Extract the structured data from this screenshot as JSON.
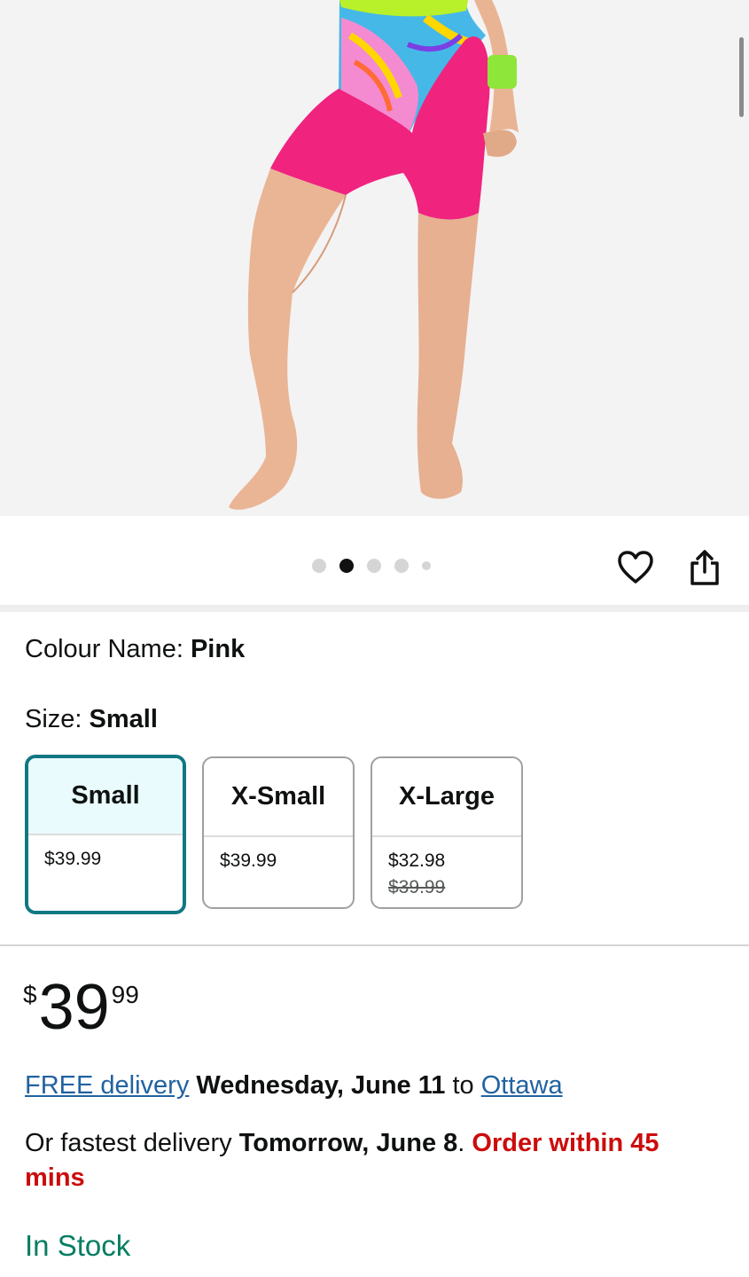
{
  "carousel": {
    "dot_count": 5,
    "active_index": 1
  },
  "actions": {
    "wishlist_icon": "heart-icon",
    "share_icon": "share-icon"
  },
  "colour": {
    "label": "Colour Name: ",
    "value": "Pink"
  },
  "size": {
    "label": "Size: ",
    "value": "Small",
    "options": [
      {
        "name": "Small",
        "price": "$39.99",
        "was": ""
      },
      {
        "name": "X-Small",
        "price": "$39.99",
        "was": ""
      },
      {
        "name": "X-Large",
        "price": "$32.98",
        "was": "$39.99"
      }
    ]
  },
  "price": {
    "symbol": "$",
    "whole": "39",
    "fraction": "99"
  },
  "delivery": {
    "link": "FREE delivery",
    "date": "Wednesday, June 11",
    "to": " to ",
    "location": "Ottawa"
  },
  "fastest": {
    "prefix": "Or fastest delivery ",
    "date": "Tomorrow, June 8",
    "dot": ". ",
    "urgency": "Order within 45 mins"
  },
  "stock": {
    "status": "In Stock"
  },
  "colors": {
    "accent": "#117883",
    "link": "#2162a1",
    "urgent": "#cc0c0c",
    "in_stock": "#067d62",
    "shorts": "#f0237f"
  }
}
